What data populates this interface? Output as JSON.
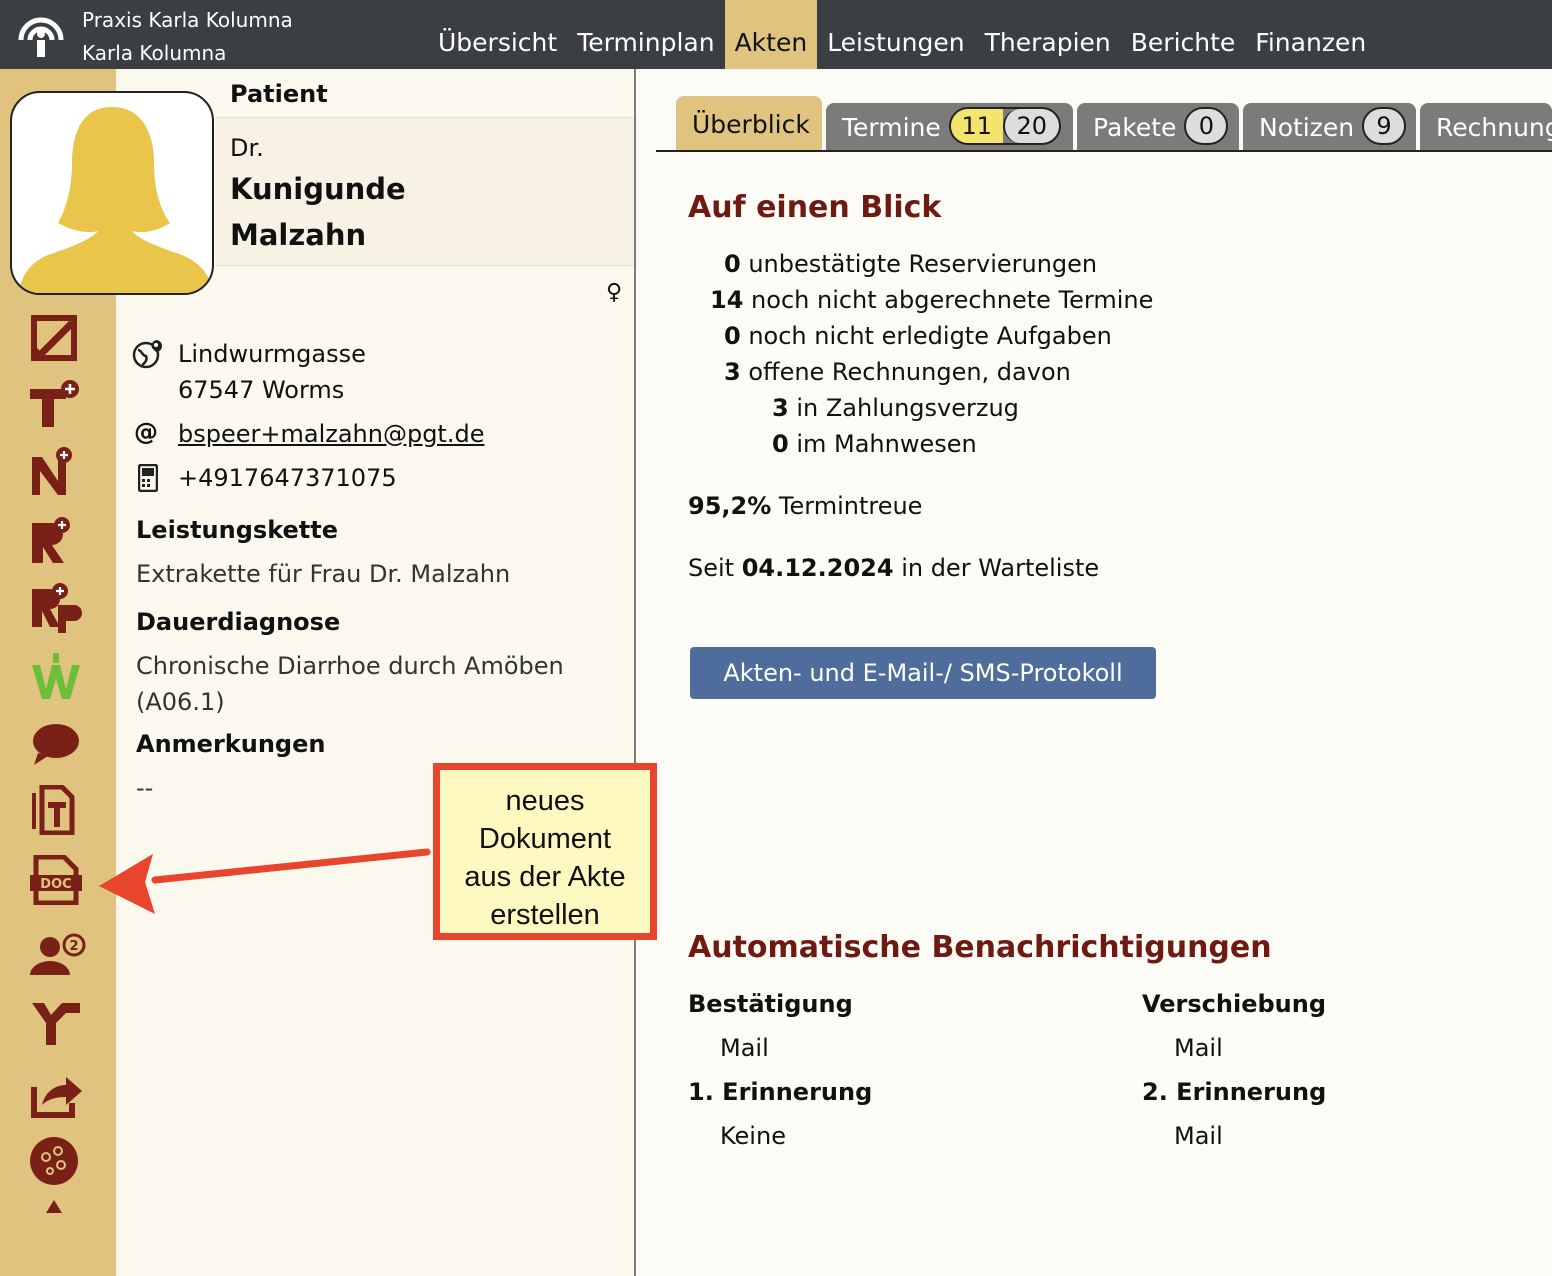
{
  "header": {
    "practice_name": "Praxis Karla Kolumna",
    "user_name": "Karla Kolumna",
    "nav": [
      "Übersicht",
      "Terminplan",
      "Akten",
      "Leistungen",
      "Therapien",
      "Berichte",
      "Finanzen"
    ],
    "active_nav": "Akten"
  },
  "sidebar_icons": [
    "edit-record-icon",
    "add-appointment-icon",
    "add-note-icon",
    "add-invoice-icon",
    "add-prescription-icon",
    "waitlist-icon",
    "message-icon",
    "text-document-icon",
    "doc-document-icon",
    "assign-therapist-icon",
    "merge-icon",
    "export-icon",
    "more-icon"
  ],
  "patient": {
    "heading": "Patient",
    "title": "Dr.",
    "first_name": "Kunigunde",
    "last_name": "Malzahn",
    "gender_symbol": "♀",
    "street": "Lindwurmgasse",
    "city": "67547 Worms",
    "email": "bspeer+malzahn@pgt.de",
    "phone": "+4917647371075",
    "chain_label": "Leistungskette",
    "chain_value": "Extrakette für Frau Dr. Malzahn",
    "diagnosis_label": "Dauerdiagnose",
    "diagnosis_value_1": "Chronische Diarrhoe durch Amöben",
    "diagnosis_value_2": "(A06.1)",
    "notes_label": "Anmerkungen",
    "notes_value": "--"
  },
  "callout": {
    "lines": [
      "neues",
      "Dokument",
      "aus der Akte",
      "erstellen"
    ]
  },
  "tabs": {
    "overview": "Überblick",
    "appointments": "Termine",
    "appointments_count_a": "11",
    "appointments_count_b": "20",
    "packages": "Pakete",
    "packages_count": "0",
    "notes": "Notizen",
    "notes_count": "9",
    "invoices": "Rechnungen"
  },
  "overview": {
    "heading": "Auf einen Blick",
    "stats": [
      {
        "value": "0",
        "label": "unbestätigte Reservierungen"
      },
      {
        "value": "14",
        "label": "noch nicht abgerechnete Termine"
      },
      {
        "value": "0",
        "label": "noch nicht erledigte Aufgaben"
      },
      {
        "value": "3",
        "label": "offene Rechnungen, davon"
      },
      {
        "value": "3",
        "label": "in Zahlungsverzug"
      },
      {
        "value": "0",
        "label": "im Mahnwesen"
      }
    ],
    "loyalty_value": "95,2%",
    "loyalty_label": "Termintreue",
    "waitlist_prefix": "Seit",
    "waitlist_date": "04.12.2024",
    "waitlist_suffix": "in der Warteliste",
    "protocol_button": "Akten- und E-Mail-/ SMS-Protokoll"
  },
  "notifications": {
    "heading": "Automatische Benachrichtigungen",
    "confirmation_label": "Bestätigung",
    "confirmation_value": "Mail",
    "reschedule_label": "Verschiebung",
    "reschedule_value": "Mail",
    "reminder1_label": "1. Erinnerung",
    "reminder1_value": "Keine",
    "reminder2_label": "2. Erinnerung",
    "reminder2_value": "Mail"
  },
  "colors": {
    "topbar": "#3b3e42",
    "accent": "#dfc37f",
    "icon": "#7a2117",
    "heading": "#6e1a12",
    "button": "#4e6d9c",
    "callout_border": "#e8452c",
    "callout_bg": "#fef9c0"
  }
}
